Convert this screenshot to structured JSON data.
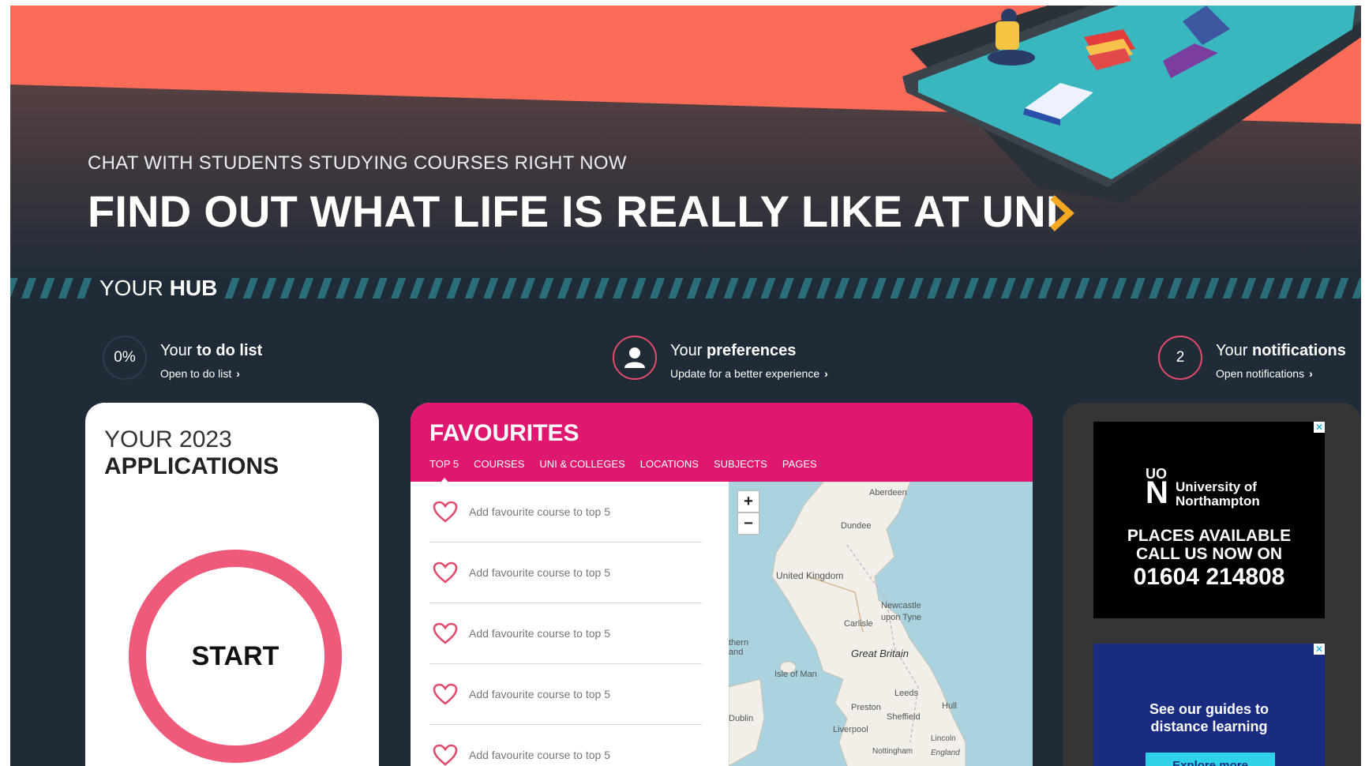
{
  "hero": {
    "eyebrow": "CHAT WITH STUDENTS STUDYING COURSES RIGHT NOW",
    "title": "FIND OUT WHAT LIFE IS REALLY LIKE AT UNI",
    "colors": {
      "top": "#fa6b58",
      "bottom": "#1f2b37",
      "chevron": "#f7a823"
    }
  },
  "hub": {
    "label_prefix": "YOUR",
    "label_bold": "HUB",
    "todo": {
      "value": "0%",
      "prefix": "Your",
      "bold": "to do list",
      "link": "Open to do list"
    },
    "preferences": {
      "icon": "user-icon",
      "prefix": "Your",
      "bold": "preferences",
      "link": "Update for a better experience"
    },
    "notifications": {
      "value": "2",
      "prefix": "Your",
      "bold": "notifications",
      "link": "Open notifications"
    }
  },
  "applications": {
    "year_line": "YOUR 2023",
    "heading": "APPLICATIONS",
    "start_label": "START",
    "ring_color": "#ef5a7a"
  },
  "favourites": {
    "title": "FAVOURITES",
    "tabs": [
      "TOP 5",
      "COURSES",
      "UNI & COLLEGES",
      "LOCATIONS",
      "SUBJECTS",
      "PAGES"
    ],
    "active_tab": "TOP 5",
    "items": [
      "Add favourite course to top 5",
      "Add favourite course to top 5",
      "Add favourite course to top 5",
      "Add favourite course to top 5",
      "Add favourite course to top 5"
    ],
    "accent": "#e0176f",
    "map": {
      "zoom_in": "+",
      "zoom_out": "−",
      "labels": {
        "aberdeen": "Aberdeen",
        "dundee": "Dundee",
        "uk": "United Kingdom",
        "newcastle": "Newcastle",
        "upon_tyne": "upon Tyne",
        "carlisle": "Carlisle",
        "great_britain": "Great Britain",
        "isle_of_man": "Isle of Man",
        "leeds": "Leeds",
        "hull": "Hull",
        "preston": "Preston",
        "sheffield": "Sheffield",
        "liverpool": "Liverpool",
        "dublin": "Dublin",
        "lincoln": "Lincoln",
        "nottingham": "Nottingham",
        "england": "England",
        "ireland_partial": "thern\nand"
      }
    }
  },
  "ads": {
    "ad1": {
      "close": "✕",
      "logo_uo": "UO",
      "logo_n": "N",
      "logo_name": "University of\nNorthampton",
      "line1": "PLACES AVAILABLE",
      "line2": "CALL US NOW ON",
      "phone": "01604 214808"
    },
    "ad2": {
      "close": "✕",
      "text": "See our guides to\ndistance learning",
      "button": "Explore more"
    }
  }
}
